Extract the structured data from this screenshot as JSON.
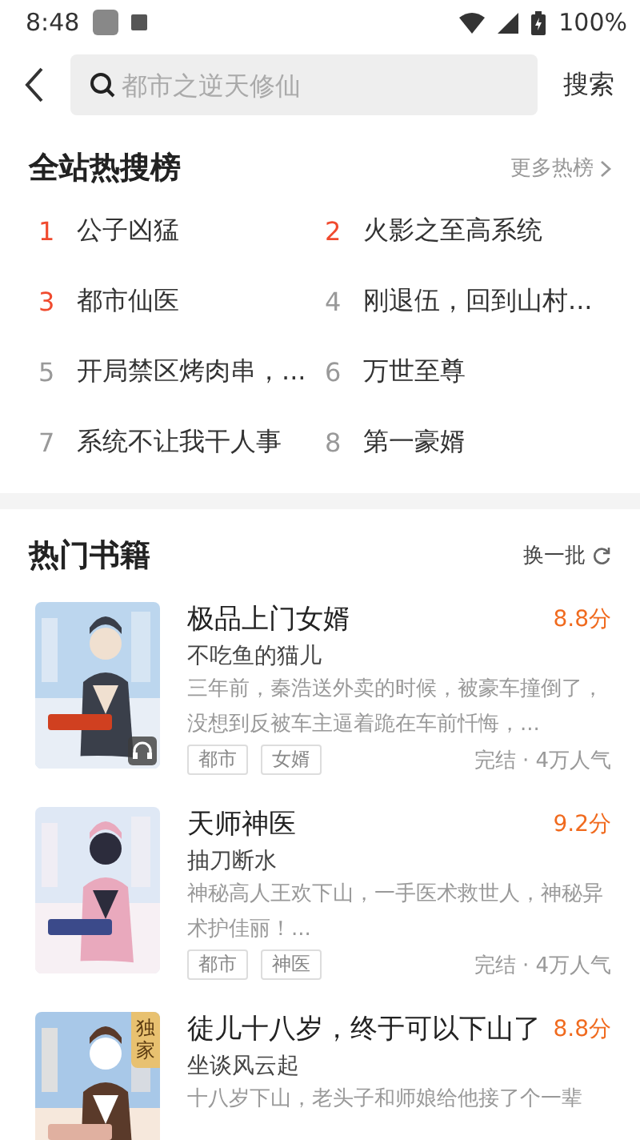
{
  "status_bar": {
    "time": "8:48",
    "battery": "100%"
  },
  "search": {
    "placeholder": "都市之逆天修仙",
    "button": "搜索"
  },
  "hot_search": {
    "title": "全站热搜榜",
    "more": "更多热榜",
    "items": [
      {
        "rank": "1",
        "title": "公子凶猛",
        "color": "#f04a2e"
      },
      {
        "rank": "2",
        "title": "火影之至高系统",
        "color": "#f04a2e"
      },
      {
        "rank": "3",
        "title": "都市仙医",
        "color": "#f04a2e"
      },
      {
        "rank": "4",
        "title": "刚退伍，回到山村...",
        "color": "#999999"
      },
      {
        "rank": "5",
        "title": "开局禁区烤肉串，...",
        "color": "#999999"
      },
      {
        "rank": "6",
        "title": "万世至尊",
        "color": "#999999"
      },
      {
        "rank": "7",
        "title": "系统不让我干人事",
        "color": "#999999"
      },
      {
        "rank": "8",
        "title": "第一豪婿",
        "color": "#999999"
      }
    ]
  },
  "hot_books": {
    "title": "热门书籍",
    "refresh": "换一批",
    "books": [
      {
        "title": "极品上门女婿",
        "score": "8.8分",
        "author": "不吃鱼的猫儿",
        "description": "三年前，秦浩送外卖的时候，被豪车撞倒了，没想到反被车主逼着跪在车前忏悔，...",
        "tags": [
          "都市",
          "女婿"
        ],
        "status": "完结 · 4万人气",
        "audio": true
      },
      {
        "title": "天师神医",
        "score": "9.2分",
        "author": "抽刀断水",
        "description": "神秘高人王欢下山，一手医术救世人，神秘异术护佳丽！...",
        "tags": [
          "都市",
          "神医"
        ],
        "status": "完结 · 4万人气",
        "audio": false
      },
      {
        "title": "徒儿十八岁，终于可以下山了",
        "score": "8.8分",
        "author": "坐谈风云起",
        "description": "十八岁下山，老头子和师娘给他接了个一辈",
        "audio": false,
        "badge": "独家"
      }
    ]
  }
}
